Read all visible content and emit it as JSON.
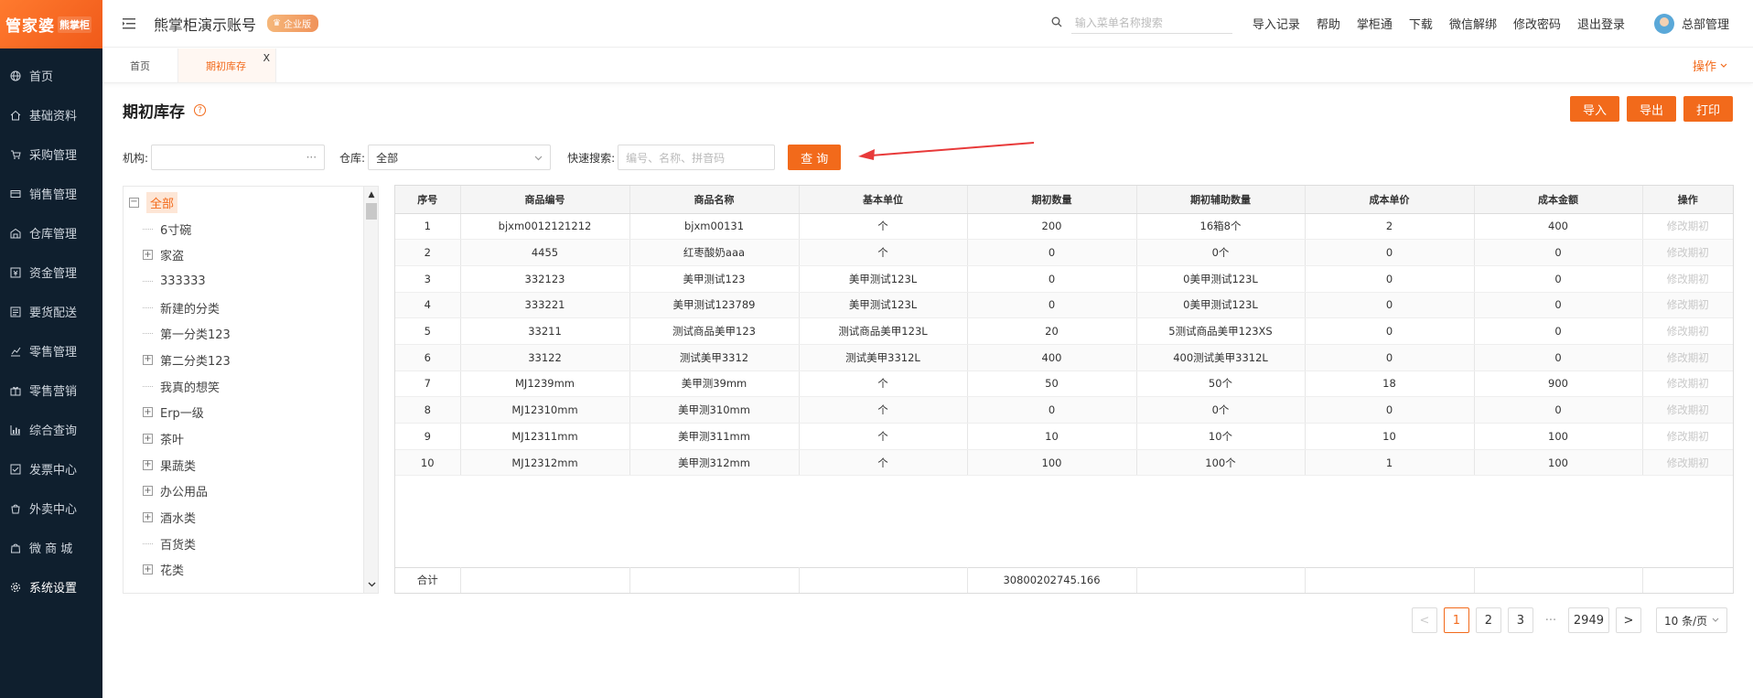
{
  "logo": {
    "brand": "管家婆",
    "sub": "熊掌柜"
  },
  "sidebar": {
    "items": [
      {
        "label": "首页",
        "icon": "globe-icon"
      },
      {
        "label": "基础资料",
        "icon": "home-icon"
      },
      {
        "label": "采购管理",
        "icon": "cart-icon"
      },
      {
        "label": "销售管理",
        "icon": "card-icon"
      },
      {
        "label": "仓库管理",
        "icon": "warehouse-icon"
      },
      {
        "label": "资金管理",
        "icon": "money-icon"
      },
      {
        "label": "要货配送",
        "icon": "delivery-icon"
      },
      {
        "label": "零售管理",
        "icon": "chart-icon"
      },
      {
        "label": "零售营销",
        "icon": "gift-icon"
      },
      {
        "label": "综合查询",
        "icon": "bar-chart-icon"
      },
      {
        "label": "发票中心",
        "icon": "invoice-icon"
      },
      {
        "label": "外卖中心",
        "icon": "takeout-icon"
      },
      {
        "label": "微 商 城",
        "icon": "shop-icon"
      },
      {
        "label": "系统设置",
        "icon": "gear-icon"
      }
    ]
  },
  "header": {
    "account_name": "熊掌柜演示账号",
    "edition_badge": "企业版",
    "search_placeholder": "输入菜单名称搜索",
    "links": [
      "导入记录",
      "帮助",
      "掌柜通",
      "下载",
      "微信解绑",
      "修改密码",
      "退出登录"
    ],
    "user_name": "总部管理"
  },
  "tabs": {
    "items": [
      {
        "label": "首页",
        "active": false
      },
      {
        "label": "期初库存",
        "active": true,
        "close": "X"
      }
    ],
    "ops_label": "操作"
  },
  "page": {
    "title": "期初库存",
    "help": "?",
    "actions": {
      "import": "导入",
      "export": "导出",
      "print": "打印"
    }
  },
  "filters": {
    "org_label": "机构:",
    "org_more": "···",
    "warehouse_label": "仓库:",
    "warehouse_value": "全部",
    "quick_label": "快速搜索:",
    "quick_placeholder": "编号、名称、拼音码",
    "query_button": "查 询"
  },
  "tree": {
    "nodes": [
      {
        "label": "全部",
        "level": 0,
        "expander": "−",
        "selected": true
      },
      {
        "label": "6寸碗",
        "level": 1,
        "expander": ""
      },
      {
        "label": "家盗",
        "level": 1,
        "expander": "+"
      },
      {
        "label": "333333",
        "level": 1,
        "expander": ""
      },
      {
        "label": "新建的分类",
        "level": 1,
        "expander": ""
      },
      {
        "label": "第一分类123",
        "level": 1,
        "expander": ""
      },
      {
        "label": "第二分类123",
        "level": 1,
        "expander": "+"
      },
      {
        "label": "我真的想笑",
        "level": 1,
        "expander": ""
      },
      {
        "label": "Erp一级",
        "level": 1,
        "expander": "+"
      },
      {
        "label": "茶叶",
        "level": 1,
        "expander": "+"
      },
      {
        "label": "果蔬类",
        "level": 1,
        "expander": "+"
      },
      {
        "label": "办公用品",
        "level": 1,
        "expander": "+"
      },
      {
        "label": "酒水类",
        "level": 1,
        "expander": "+"
      },
      {
        "label": "百货类",
        "level": 1,
        "expander": ""
      },
      {
        "label": "花类",
        "level": 1,
        "expander": "+"
      }
    ]
  },
  "grid": {
    "columns": [
      "序号",
      "商品编号",
      "商品名称",
      "基本单位",
      "期初数量",
      "期初辅助数量",
      "成本单价",
      "成本金额",
      "操作"
    ],
    "rows": [
      [
        "1",
        "bjxm0012121212",
        "bjxm00131",
        "个",
        "200",
        "16箱8个",
        "2",
        "400",
        "修改期初"
      ],
      [
        "2",
        "4455",
        "红枣酸奶aaa",
        "个",
        "0",
        "0个",
        "0",
        "0",
        "修改期初"
      ],
      [
        "3",
        "332123",
        "美甲测试123",
        "美甲测试123L",
        "0",
        "0美甲测试123L",
        "0",
        "0",
        "修改期初"
      ],
      [
        "4",
        "333221",
        "美甲测试123789",
        "美甲测试123L",
        "0",
        "0美甲测试123L",
        "0",
        "0",
        "修改期初"
      ],
      [
        "5",
        "33211",
        "测试商品美甲123",
        "测试商品美甲123L",
        "20",
        "5测试商品美甲123XS",
        "0",
        "0",
        "修改期初"
      ],
      [
        "6",
        "33122",
        "测试美甲3312",
        "测试美甲3312L",
        "400",
        "400测试美甲3312L",
        "0",
        "0",
        "修改期初"
      ],
      [
        "7",
        "MJ1239mm",
        "美甲测39mm",
        "个",
        "50",
        "50个",
        "18",
        "900",
        "修改期初"
      ],
      [
        "8",
        "MJ12310mm",
        "美甲测310mm",
        "个",
        "0",
        "0个",
        "0",
        "0",
        "修改期初"
      ],
      [
        "9",
        "MJ12311mm",
        "美甲测311mm",
        "个",
        "10",
        "10个",
        "10",
        "100",
        "修改期初"
      ],
      [
        "10",
        "MJ12312mm",
        "美甲测312mm",
        "个",
        "100",
        "100个",
        "1",
        "100",
        "修改期初"
      ]
    ],
    "summary": [
      "合计",
      "",
      "",
      "",
      "30800202745.166",
      "",
      "",
      "",
      ""
    ]
  },
  "pagination": {
    "prev": "<",
    "pages": [
      "1",
      "2",
      "3"
    ],
    "active": "1",
    "ellipsis": "···",
    "last": "2949",
    "next": ">",
    "page_size": "10 条/页"
  },
  "colors": {
    "accent": "#f26a1b",
    "sidebar_bg": "#0f1f2e"
  }
}
